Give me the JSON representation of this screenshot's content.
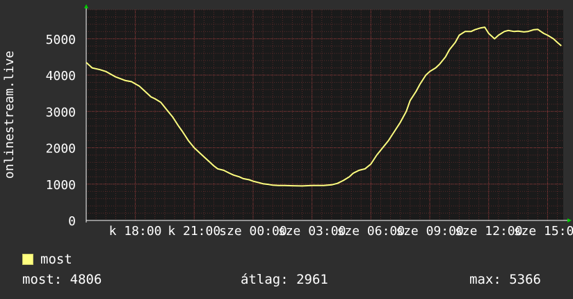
{
  "chart_data": {
    "type": "line",
    "ylabel": "onlinestream.live",
    "ylim": [
      0,
      5800
    ],
    "y_ticks": [
      "0",
      "1000",
      "2000",
      "3000",
      "4000",
      "5000"
    ],
    "x_tick_labels": [
      "k 18:00",
      "k 21:00",
      "sze 00:00",
      "sze 03:00",
      "sze 06:00",
      "sze 09:00",
      "sze 12:00",
      "sze 15:00"
    ],
    "x_tick_hours": [
      18,
      21,
      24,
      27,
      30,
      33,
      36,
      39
    ],
    "x_range_hours": [
      15.5,
      39.8
    ],
    "grid": true,
    "series": [
      {
        "name": "most",
        "color": "#ffff80",
        "x": [
          15.5,
          15.8,
          16.2,
          16.5,
          17,
          17.5,
          17.8,
          18.2,
          18.5,
          18.8,
          19,
          19.3,
          19.6,
          19.9,
          20.2,
          20.4,
          20.7,
          21,
          21.3,
          21.5,
          21.8,
          22,
          22.2,
          22.5,
          22.8,
          23,
          23.3,
          23.5,
          23.8,
          24,
          24.3,
          24.5,
          24.8,
          25,
          25.3,
          25.6,
          26,
          26.5,
          27,
          27.3,
          27.6,
          28,
          28.3,
          28.6,
          28.9,
          29.1,
          29.4,
          29.7,
          30,
          30.3,
          30.6,
          30.9,
          31.2,
          31.5,
          31.8,
          32,
          32.3,
          32.5,
          32.8,
          33,
          33.3,
          33.5,
          33.8,
          34,
          34.3,
          34.5,
          34.8,
          35.1,
          35.3,
          35.6,
          35.8,
          36,
          36.3,
          36.5,
          36.8,
          37,
          37.3,
          37.5,
          37.8,
          38,
          38.3,
          38.5,
          38.8,
          39,
          39.3,
          39.5,
          39.7
        ],
        "values": [
          4350,
          4200,
          4150,
          4100,
          3950,
          3850,
          3820,
          3700,
          3550,
          3400,
          3350,
          3250,
          3050,
          2850,
          2600,
          2450,
          2200,
          2000,
          1850,
          1750,
          1600,
          1500,
          1420,
          1380,
          1300,
          1250,
          1200,
          1150,
          1120,
          1080,
          1040,
          1010,
          990,
          970,
          960,
          960,
          955,
          950,
          960,
          960,
          960,
          980,
          1020,
          1100,
          1200,
          1300,
          1380,
          1420,
          1550,
          1800,
          2000,
          2200,
          2450,
          2700,
          3000,
          3300,
          3550,
          3750,
          4000,
          4100,
          4200,
          4300,
          4500,
          4700,
          4900,
          5100,
          5200,
          5200,
          5250,
          5300,
          5320,
          5150,
          5000,
          5100,
          5200,
          5230,
          5200,
          5210,
          5190,
          5200,
          5250,
          5260,
          5150,
          5100,
          5000,
          4900,
          4806
        ]
      }
    ]
  },
  "legend": {
    "label": "most",
    "color": "#ffff80"
  },
  "stats": {
    "current": "most: 4806",
    "average": "átlag: 2961",
    "max": "max: 5366"
  }
}
